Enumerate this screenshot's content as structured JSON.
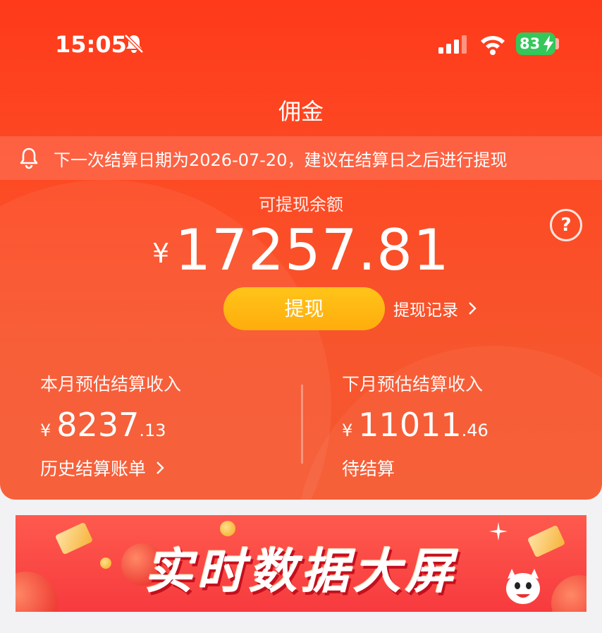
{
  "status_bar": {
    "time": "15:05",
    "battery": "83"
  },
  "header": {
    "title": "佣金"
  },
  "notice": {
    "text": "下一次结算日期为2026-07-20，建议在结算日之后进行提现"
  },
  "balance": {
    "label": "可提现余额",
    "currency": "¥",
    "amount": "17257.81"
  },
  "actions": {
    "withdraw_label": "提现",
    "record_label": "提现记录"
  },
  "this_month": {
    "label": "本月预估结算收入",
    "currency": "¥",
    "integer": "8237",
    "decimal": ".13",
    "link": "历史结算账单"
  },
  "next_month": {
    "label": "下月预估结算收入",
    "currency": "¥",
    "integer": "11011",
    "decimal": ".46",
    "link": "待结算"
  },
  "banner": {
    "text": "实时数据大屏"
  },
  "colors": {
    "accent": "#fe3a1a",
    "button": "#ffb414",
    "battery": "#34c759"
  }
}
